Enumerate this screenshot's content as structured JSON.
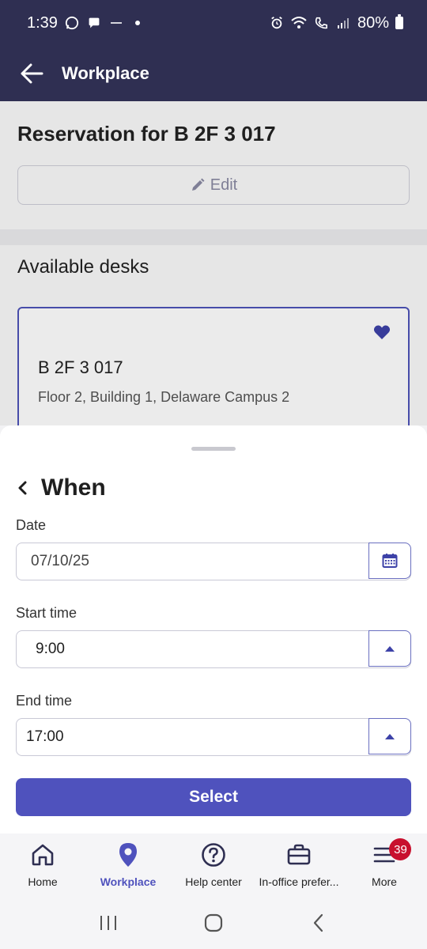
{
  "status_bar": {
    "time": "1:39",
    "battery": "80%"
  },
  "app_bar": {
    "title": "Workplace"
  },
  "reservation": {
    "title": "Reservation for B 2F 3 017",
    "edit_label": "Edit"
  },
  "available": {
    "title": "Available desks",
    "desk": {
      "name": "B 2F 3 017",
      "location": "Floor 2, Building 1, Delaware Campus 2"
    }
  },
  "sheet": {
    "title": "When",
    "date_label": "Date",
    "date_value": "07/10/25",
    "start_label": "Start time",
    "start_value": "9:00",
    "end_label": "End time",
    "end_value": "17:00",
    "select_label": "Select"
  },
  "bottom_nav": {
    "items": [
      {
        "label": "Home"
      },
      {
        "label": "Workplace"
      },
      {
        "label": "Help center"
      },
      {
        "label": "In-office prefer..."
      },
      {
        "label": "More",
        "badge": "39"
      }
    ]
  },
  "colors": {
    "header": "#2f2f52",
    "accent": "#4f52bd",
    "badge": "#c8102e"
  }
}
